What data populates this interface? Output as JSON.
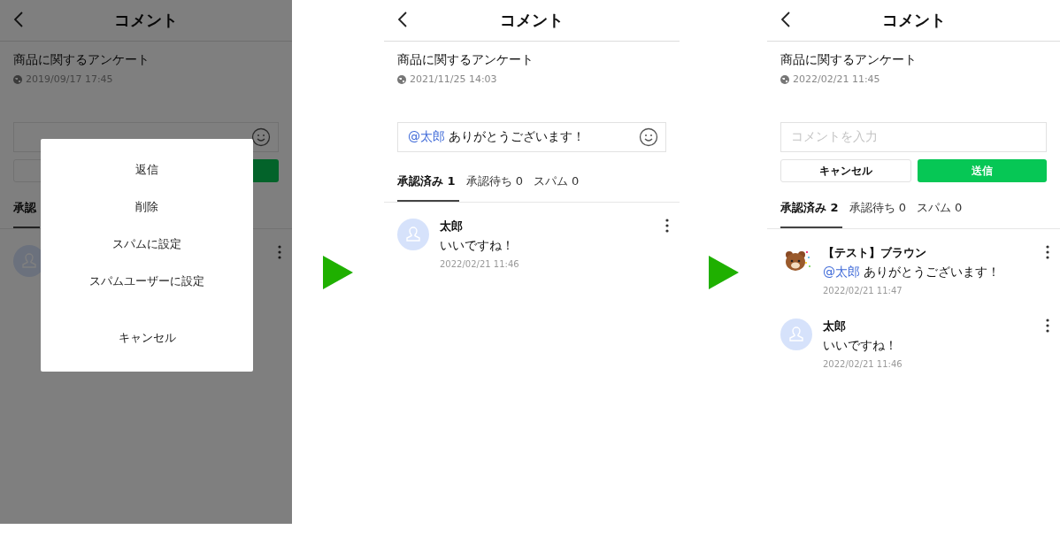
{
  "screens": [
    {
      "header": {
        "title": "コメント"
      },
      "post": {
        "title": "商品に関するアンケート",
        "date": "2019/09/17 17:45"
      },
      "input": {
        "kind": "covered"
      },
      "buttons": [
        {
          "kind": "cancel"
        },
        {
          "kind": "send"
        }
      ],
      "tabs": [
        {
          "label": "承認",
          "selected": true
        }
      ],
      "comments": [
        {
          "kind": "person"
        }
      ],
      "action_sheet": [
        {
          "label": "返信",
          "kind": "action"
        },
        {
          "label": "削除",
          "kind": "action"
        },
        {
          "label": "スパムに設定",
          "kind": "action"
        },
        {
          "label": "スパムユーザーに設定",
          "kind": "action"
        },
        {
          "label": "キャンセル",
          "kind": "cancel"
        }
      ]
    },
    {
      "header": {
        "title": "コメント"
      },
      "post": {
        "title": "商品に関するアンケート",
        "date": "2021/11/25 14:03"
      },
      "input": {
        "kind": "value",
        "mention": "@太郎",
        "value": "ありがとうございます！"
      },
      "tabs": [
        {
          "label": "承認済み 1",
          "selected": true
        },
        {
          "label": "承認待ち 0",
          "selected": false
        },
        {
          "label": "スパム 0",
          "selected": false
        }
      ],
      "comments": [
        {
          "kind": "person",
          "name": "太郎",
          "text": "いいですね！",
          "time": "2022/02/21 11:46"
        }
      ]
    },
    {
      "header": {
        "title": "コメント"
      },
      "post": {
        "title": "商品に関するアンケート",
        "date": "2022/02/21 11:45"
      },
      "input": {
        "kind": "placeholder",
        "placeholder": "コメントを入力"
      },
      "buttons": [
        {
          "kind": "cancel",
          "label": "キャンセル"
        },
        {
          "kind": "send",
          "label": "送信"
        }
      ],
      "tabs": [
        {
          "label": "承認済み 2",
          "selected": true
        },
        {
          "label": "承認待ち 0",
          "selected": false
        },
        {
          "label": "スパム 0",
          "selected": false
        }
      ],
      "comments": [
        {
          "kind": "bear",
          "name": "【テスト】ブラウン",
          "mention": "@太郎",
          "text": "ありがとうございます！",
          "time": "2022/02/21 11:47"
        },
        {
          "kind": "person",
          "name": "太郎",
          "text": "いいですね！",
          "time": "2022/02/21 11:46"
        }
      ]
    }
  ]
}
